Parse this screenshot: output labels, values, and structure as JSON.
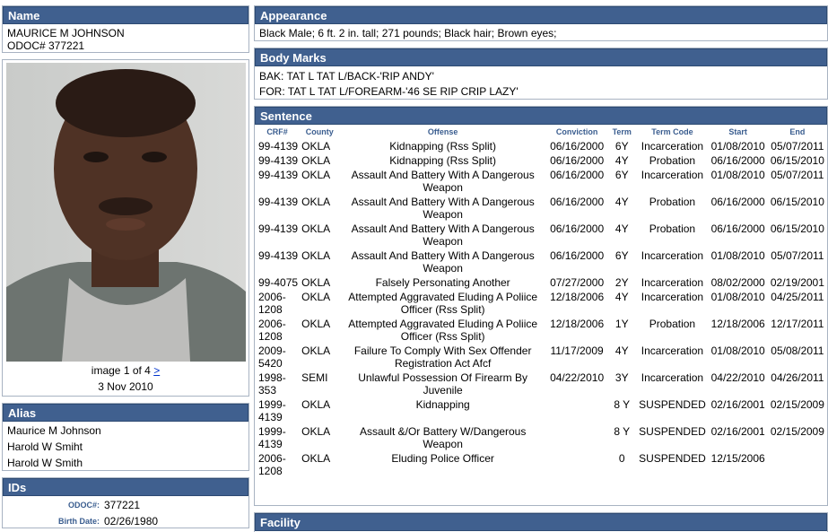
{
  "name_panel": {
    "header": "Name",
    "full_name": "MAURICE M JOHNSON",
    "odoc": "ODOC# 377221"
  },
  "photo_panel": {
    "caption_prefix": "image 1 of 4",
    "next_link": ">",
    "date": "3 Nov 2010"
  },
  "alias_panel": {
    "header": "Alias",
    "items": [
      "Maurice M Johnson",
      "Harold W Smiht",
      "Harold W Smith"
    ]
  },
  "ids_panel": {
    "header": "IDs",
    "rows": [
      {
        "label": "ODOC#:",
        "value": "377221"
      },
      {
        "label": "Birth Date:",
        "value": "02/26/1980"
      }
    ]
  },
  "appearance_panel": {
    "header": "Appearance",
    "text": "Black Male; 6 ft. 2 in. tall; 271 pounds; Black hair; Brown eyes;"
  },
  "bodymarks_panel": {
    "header": "Body Marks",
    "lines": [
      "BAK: TAT L TAT L/BACK-'RIP ANDY'",
      "FOR: TAT L TAT L/FOREARM-'46 SE RIP CRIP LAZY'"
    ]
  },
  "sentence_panel": {
    "header": "Sentence",
    "columns": [
      "CRF#",
      "County",
      "Offense",
      "Conviction",
      "Term",
      "Term Code",
      "Start",
      "End"
    ],
    "rows": [
      {
        "crf": "99-4139",
        "county": "OKLA",
        "offense": "Kidnapping (Rss Split)",
        "conviction": "06/16/2000",
        "term": "6Y",
        "code": "Incarceration",
        "start": "01/08/2010",
        "end": "05/07/2011"
      },
      {
        "crf": "99-4139",
        "county": "OKLA",
        "offense": "Kidnapping (Rss Split)",
        "conviction": "06/16/2000",
        "term": "4Y",
        "code": "Probation",
        "start": "06/16/2000",
        "end": "06/15/2010"
      },
      {
        "crf": "99-4139",
        "county": "OKLA",
        "offense": "Assault And Battery With A Dangerous Weapon",
        "conviction": "06/16/2000",
        "term": "6Y",
        "code": "Incarceration",
        "start": "01/08/2010",
        "end": "05/07/2011"
      },
      {
        "crf": "99-4139",
        "county": "OKLA",
        "offense": "Assault And Battery With A Dangerous Weapon",
        "conviction": "06/16/2000",
        "term": "4Y",
        "code": "Probation",
        "start": "06/16/2000",
        "end": "06/15/2010"
      },
      {
        "crf": "99-4139",
        "county": "OKLA",
        "offense": "Assault And Battery With A Dangerous Weapon",
        "conviction": "06/16/2000",
        "term": "4Y",
        "code": "Probation",
        "start": "06/16/2000",
        "end": "06/15/2010"
      },
      {
        "crf": "99-4139",
        "county": "OKLA",
        "offense": "Assault And Battery With A Dangerous Weapon",
        "conviction": "06/16/2000",
        "term": "6Y",
        "code": "Incarceration",
        "start": "01/08/2010",
        "end": "05/07/2011"
      },
      {
        "crf": "99-4075",
        "county": "OKLA",
        "offense": "Falsely Personating Another",
        "conviction": "07/27/2000",
        "term": "2Y",
        "code": "Incarceration",
        "start": "08/02/2000",
        "end": "02/19/2001"
      },
      {
        "crf": "2006-1208",
        "county": "OKLA",
        "offense": "Attempted Aggravated Eluding A Poliice Officer (Rss Split)",
        "conviction": "12/18/2006",
        "term": "4Y",
        "code": "Incarceration",
        "start": "01/08/2010",
        "end": "04/25/2011"
      },
      {
        "crf": "2006-1208",
        "county": "OKLA",
        "offense": "Attempted Aggravated Eluding A Poliice Officer (Rss Split)",
        "conviction": "12/18/2006",
        "term": "1Y",
        "code": "Probation",
        "start": "12/18/2006",
        "end": "12/17/2011"
      },
      {
        "crf": "2009-5420",
        "county": "OKLA",
        "offense": "Failure To Comply With Sex Offender Registration Act Afcf",
        "conviction": "11/17/2009",
        "term": "4Y",
        "code": "Incarceration",
        "start": "01/08/2010",
        "end": "05/08/2011"
      },
      {
        "crf": "1998-353",
        "county": "SEMI",
        "offense": "Unlawful Possession Of Firearm By Juvenile",
        "conviction": "04/22/2010",
        "term": "3Y",
        "code": "Incarceration",
        "start": "04/22/2010",
        "end": "04/26/2011"
      },
      {
        "crf": "1999-4139",
        "county": "OKLA",
        "offense": "Kidnapping",
        "conviction": "",
        "term": "8 Y",
        "code": "SUSPENDED",
        "start": "02/16/2001",
        "end": "02/15/2009"
      },
      {
        "crf": "1999-4139",
        "county": "OKLA",
        "offense": "Assault &/Or Battery W/Dangerous Weapon",
        "conviction": "",
        "term": "8 Y",
        "code": "SUSPENDED",
        "start": "02/16/2001",
        "end": "02/15/2009"
      },
      {
        "crf": "2006-1208",
        "county": "OKLA",
        "offense": "Eluding Police Officer",
        "conviction": "",
        "term": "0",
        "code": "SUSPENDED",
        "start": "12/15/2006",
        "end": ""
      }
    ]
  },
  "facility_panel": {
    "header": "Facility"
  },
  "colors": {
    "header_bg": "#40608f",
    "label_blue": "#3a5d8f",
    "link": "#0033cc"
  }
}
